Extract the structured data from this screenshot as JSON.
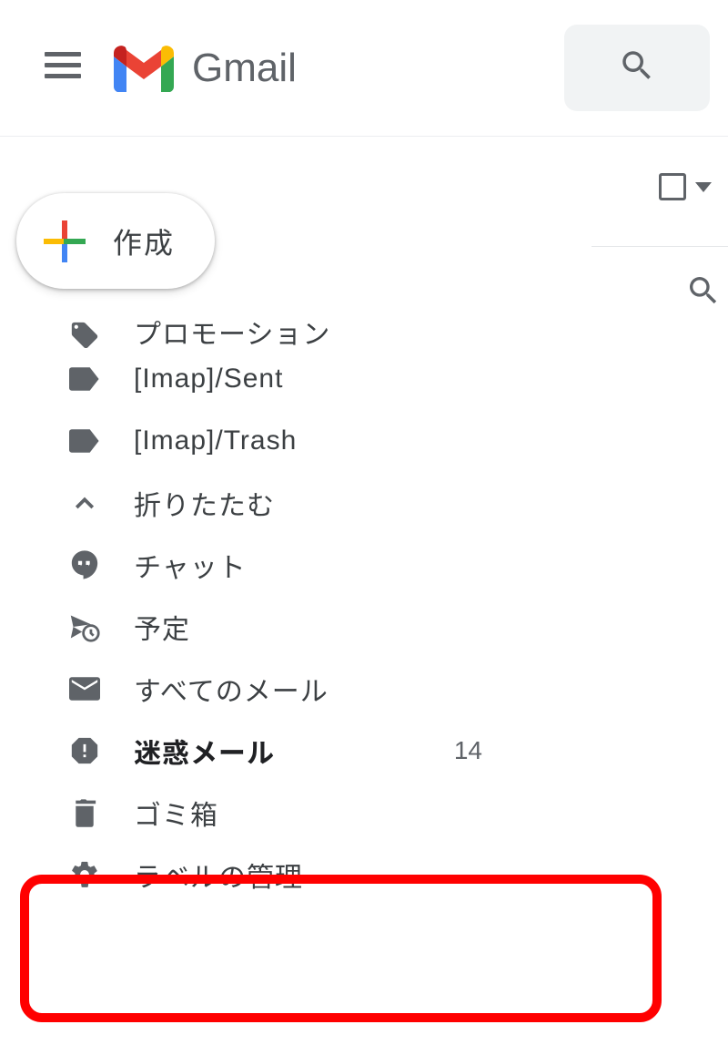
{
  "header": {
    "app_name": "Gmail"
  },
  "compose": {
    "label": "作成"
  },
  "sidebar": {
    "items": [
      {
        "icon": "tag-icon",
        "label": "プロモーション"
      },
      {
        "icon": "label-icon",
        "label": "[Imap]/Sent"
      },
      {
        "icon": "label-icon",
        "label": "[Imap]/Trash"
      },
      {
        "icon": "chevron-up-icon",
        "label": "折りたたむ"
      },
      {
        "icon": "hangouts-icon",
        "label": "チャット"
      },
      {
        "icon": "schedule-icon",
        "label": "予定"
      },
      {
        "icon": "mail-icon",
        "label": "すべてのメール"
      },
      {
        "icon": "spam-icon",
        "label": "迷惑メール",
        "count": "14",
        "bold": true
      },
      {
        "icon": "trash-icon",
        "label": "ゴミ箱"
      },
      {
        "icon": "gear-icon",
        "label": "ラベルの管理"
      }
    ]
  },
  "colors": {
    "highlight": "#ff0000",
    "text": "#5f6368",
    "google_blue": "#4285f4",
    "google_red": "#ea4335",
    "google_yellow": "#fbbc04",
    "google_green": "#34a853"
  }
}
